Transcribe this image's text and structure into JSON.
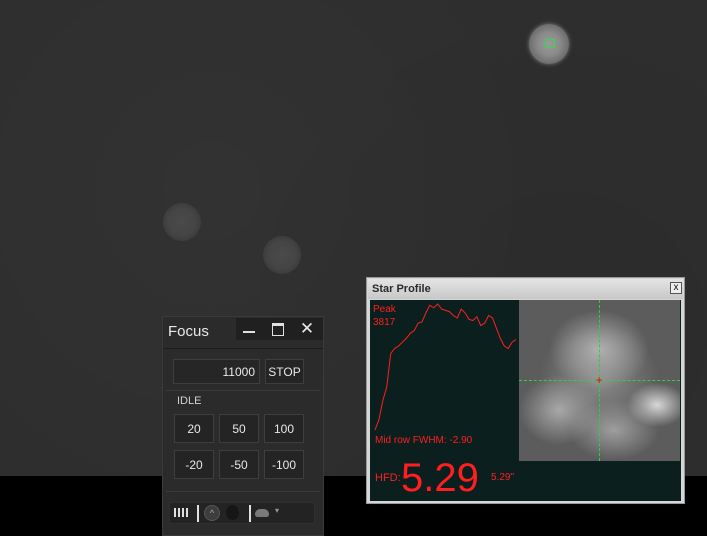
{
  "focus_panel": {
    "title": "Focus",
    "position_value": "11000",
    "stop_label": "STOP",
    "status": "IDLE",
    "steps_row1": [
      "20",
      "50",
      "100"
    ],
    "steps_row2": [
      "-20",
      "-50",
      "-100"
    ],
    "window_buttons": {
      "minimize": "",
      "maximize": "",
      "close": "✕"
    },
    "toolbar": {
      "caret": "▾",
      "circle": "^"
    }
  },
  "star_profile": {
    "title": "Star Profile",
    "close": "x",
    "peak_label": "Peak",
    "peak_value": "3817",
    "fwhm_text": "Mid row FWHM: -2.90",
    "hfd_label": "HFD:",
    "hfd_value": "5.29",
    "hfd_arcsec": "5.29\"",
    "centroid_marker": "+",
    "profile_color": "#ff1f1f",
    "profile_values": [
      0,
      80,
      230,
      340,
      600,
      640,
      660,
      690,
      720,
      760,
      780,
      840,
      850,
      920,
      980,
      960,
      990,
      950,
      940,
      930,
      900,
      880,
      950,
      920,
      870,
      860,
      890,
      820,
      840,
      900,
      880,
      800,
      720,
      660,
      640,
      690,
      710
    ]
  },
  "colors": {
    "sky_background": "#2e2e2e",
    "selection_box": "#2fdc4a",
    "crosshair": "#2fcf3f",
    "text_red": "#ff1f1f"
  }
}
